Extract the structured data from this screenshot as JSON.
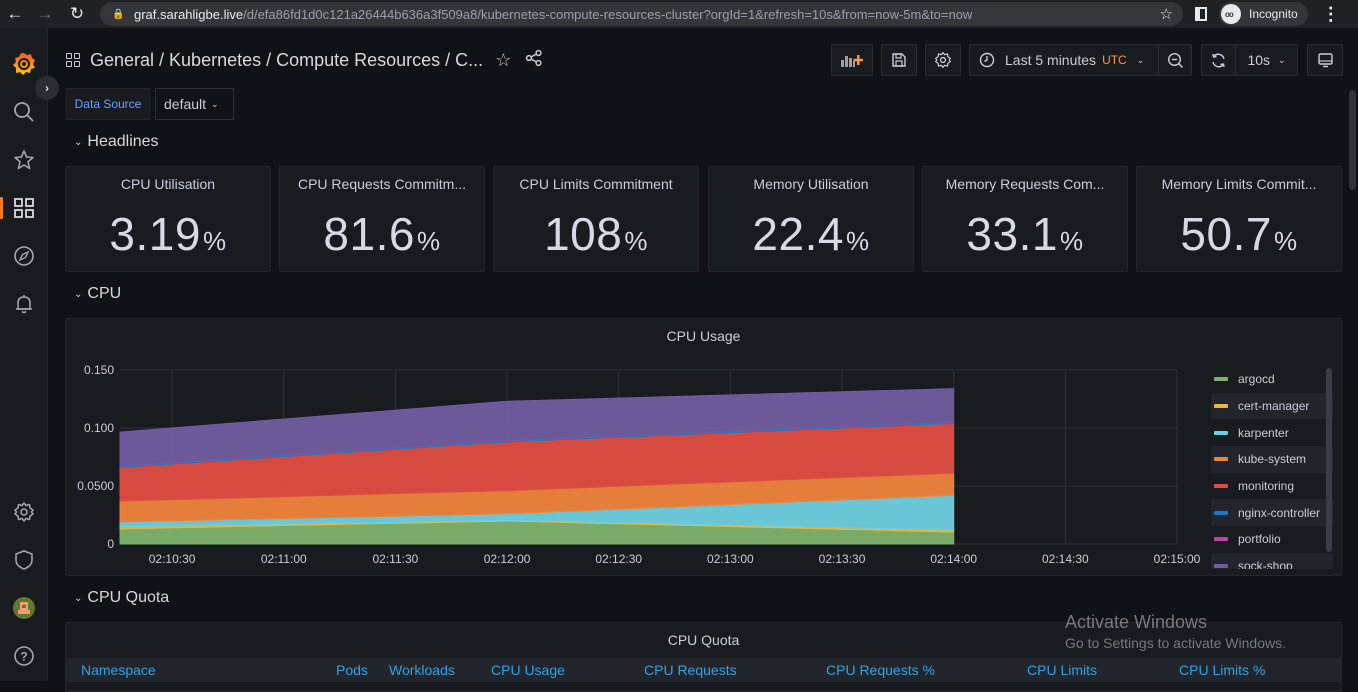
{
  "browser": {
    "url_host": "graf.sarahligbe.live",
    "url_path": "/d/efa86fd1d0c121a26444b636a3f509a8/kubernetes-compute-resources-cluster?orgId=1&refresh=10s&from=now-5m&to=now",
    "profile_label": "Incognito"
  },
  "sidebar": {
    "items": [
      {
        "name": "grafana-logo",
        "icon": "grafana-logo-icon"
      },
      {
        "name": "search",
        "icon": "search-icon"
      },
      {
        "name": "starred",
        "icon": "star-icon"
      },
      {
        "name": "dashboards",
        "icon": "dashboards-icon",
        "active": true
      },
      {
        "name": "explore",
        "icon": "compass-icon"
      },
      {
        "name": "alerting",
        "icon": "bell-icon"
      },
      {
        "name": "configuration",
        "icon": "gear-icon"
      },
      {
        "name": "server-admin",
        "icon": "shield-icon"
      },
      {
        "name": "profile",
        "icon": "avatar-icon"
      },
      {
        "name": "help",
        "icon": "help-icon"
      }
    ]
  },
  "header": {
    "title": "General  / Kubernetes / Compute Resources / C...",
    "time_range": "Last 5 minutes",
    "timezone": "UTC",
    "refresh_interval": "10s"
  },
  "variables": {
    "datasource_label": "Data Source",
    "datasource_value": "default"
  },
  "rows": {
    "headlines": "Headlines",
    "cpu": "CPU",
    "cpu_quota": "CPU Quota"
  },
  "stats": [
    {
      "title": "CPU Utilisation",
      "value": "3.19",
      "unit": "%"
    },
    {
      "title": "CPU Requests Commitm...",
      "value": "81.6",
      "unit": "%"
    },
    {
      "title": "CPU Limits Commitment",
      "value": "108",
      "unit": "%"
    },
    {
      "title": "Memory Utilisation",
      "value": "22.4",
      "unit": "%"
    },
    {
      "title": "Memory Requests Com...",
      "value": "33.1",
      "unit": "%"
    },
    {
      "title": "Memory Limits Commit...",
      "value": "50.7",
      "unit": "%"
    }
  ],
  "chart_data": {
    "type": "area",
    "stacked": true,
    "title": "CPU Usage",
    "xlabel": "",
    "ylabel": "",
    "x": [
      "02:10:16",
      "02:12:00",
      "02:14:00"
    ],
    "x_ticks": [
      "02:10:30",
      "02:11:00",
      "02:11:30",
      "02:12:00",
      "02:12:30",
      "02:13:00",
      "02:13:30",
      "02:14:00",
      "02:14:30",
      "02:15:00"
    ],
    "x_range": [
      "02:10:16",
      "02:15:00"
    ],
    "y_ticks": [
      "0",
      "0.0500",
      "0.100",
      "0.150"
    ],
    "ylim": [
      0,
      0.15
    ],
    "grid": true,
    "legend_position": "right",
    "series": [
      {
        "name": "argocd",
        "color": "#7eb26d",
        "values": [
          0.013,
          0.0198,
          0.0103
        ]
      },
      {
        "name": "cert-manager",
        "color": "#eab839",
        "values": [
          0.0017,
          0.0005,
          0.0017
        ]
      },
      {
        "name": "karpenter",
        "color": "#6ed0e0",
        "values": [
          0.0043,
          0.0057,
          0.03
        ]
      },
      {
        "name": "kube-system",
        "color": "#ef843c",
        "values": [
          0.018,
          0.02,
          0.019
        ]
      },
      {
        "name": "monitoring",
        "color": "#e24d42",
        "values": [
          0.029,
          0.042,
          0.043
        ]
      },
      {
        "name": "nginx-controller",
        "color": "#1f78c1",
        "values": [
          0.001,
          0.001,
          0.001
        ]
      },
      {
        "name": "portfolio",
        "color": "#ba43a9",
        "values": [
          0,
          0,
          0
        ]
      },
      {
        "name": "sock-shop",
        "color": "#705da0",
        "values": [
          0.0295,
          0.034,
          0.029
        ]
      }
    ]
  },
  "cpu_quota_table": {
    "title": "CPU Quota",
    "columns": [
      "Namespace",
      "Pods",
      "Workloads",
      "CPU Usage",
      "CPU Requests",
      "CPU Requests %",
      "CPU Limits",
      "CPU Limits %"
    ]
  },
  "watermark": {
    "line1": "Activate Windows",
    "line2": "Go to Settings to activate Windows."
  }
}
